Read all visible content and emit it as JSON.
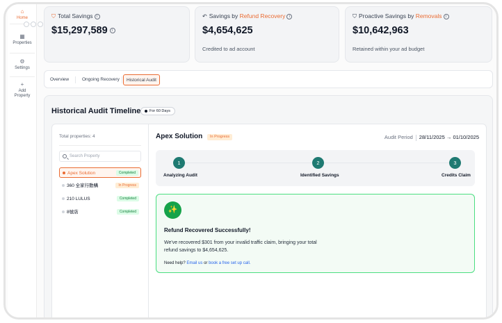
{
  "sidebar": {
    "items": [
      {
        "label": "Home",
        "icon": "home-icon"
      },
      {
        "label": "Properties",
        "icon": "grid-icon"
      },
      {
        "label": "Settings",
        "icon": "gear-icon"
      },
      {
        "label": "Add Property",
        "icon": "plus-icon"
      }
    ]
  },
  "stats": [
    {
      "title": "Total Savings",
      "title_highlight": "",
      "value": "$15,297,589",
      "sub": ""
    },
    {
      "title": "Savings by ",
      "title_highlight": "Refund Recovery",
      "value": "$4,654,625",
      "sub": "Credited to ad account"
    },
    {
      "title": "Proactive Savings by ",
      "title_highlight": "Removals",
      "value": "$10,642,963",
      "sub": "Retained within your ad budget"
    }
  ],
  "tabs": [
    "Overview",
    "Ongoing Recovery",
    "Historical Audit"
  ],
  "active_tab": "Historical Audit",
  "panel": {
    "title": "Historical Audit Timeline",
    "range_pill": "For 60 Days",
    "total_properties": "Total properties: 4",
    "search_placeholder": "Search Property",
    "properties": [
      {
        "name": "Apex Solution",
        "status": "Completed"
      },
      {
        "name": "360 全家行動購",
        "status": "In Progress"
      },
      {
        "name": "210 LULUS",
        "status": "Completed"
      },
      {
        "name": "8號店",
        "status": "Completed"
      }
    ]
  },
  "detail": {
    "name": "Apex Solution",
    "status": "In Progress",
    "period_label": "Audit Period",
    "period_start": "28/11/2025",
    "period_end": "01/10/2025",
    "steps": [
      {
        "num": "1",
        "label": "Analyzing Audit"
      },
      {
        "num": "2",
        "label": "Identified Savings"
      },
      {
        "num": "3",
        "label": "Credits Claim"
      }
    ],
    "success_title": "Refund Recovered Successfully!",
    "success_body": "We've recovered $301 from your invalid traffic claim, bringing your total refund savings to $4,654,625.",
    "help_prefix": "Need help?",
    "help_link1": "Email us",
    "help_or": "or",
    "help_link2": "book a free set up call."
  },
  "colors": {
    "accent": "#ea6b32",
    "success": "#16a34a",
    "step": "#1f7a72"
  }
}
